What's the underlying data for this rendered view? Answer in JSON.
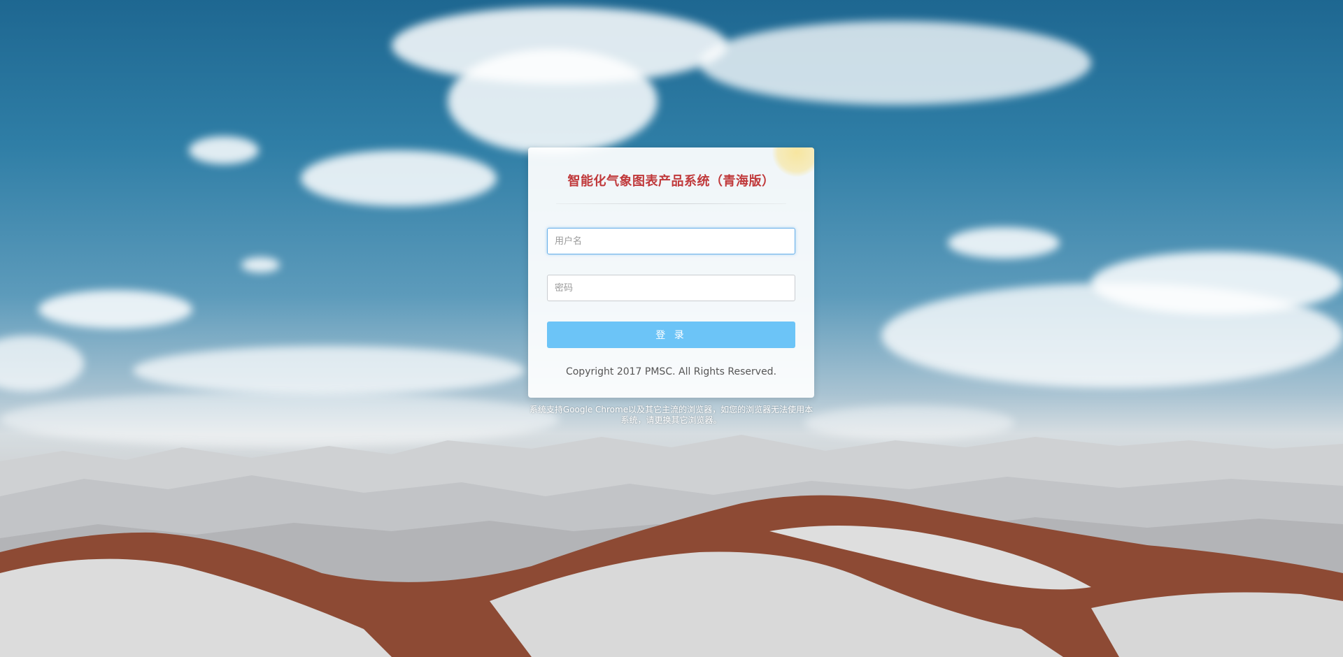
{
  "login": {
    "title": "智能化气象图表产品系统（青海版）",
    "username_placeholder": "用户名",
    "username_value": "",
    "password_placeholder": "密码",
    "password_value": "",
    "login_label": "登 录",
    "copyright": "Copyright 2017 PMSC. All Rights Reserved."
  },
  "browser_notice": "系统支持Google Chrome以及其它主流的浏览器，如您的浏览器无法使用本系统，请更换其它浏览器。",
  "colors": {
    "title": "#c0393b",
    "button": "#6cc4f7",
    "focus_border": "#66afe9"
  }
}
